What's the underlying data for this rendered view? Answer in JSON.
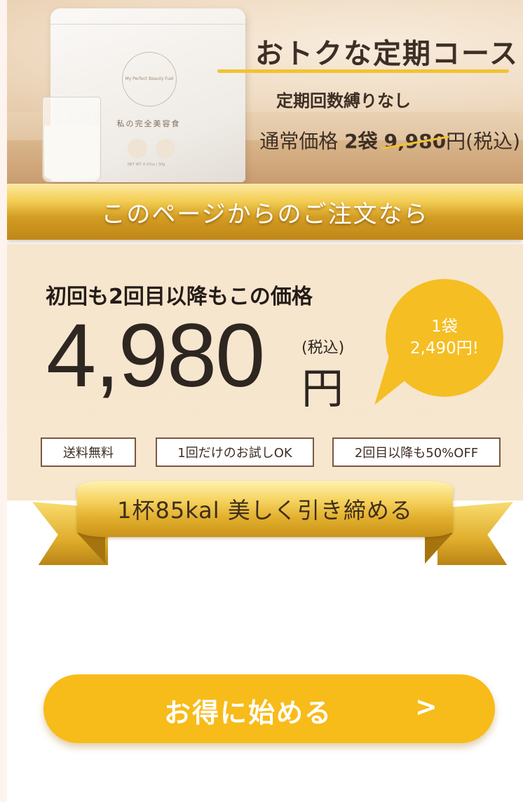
{
  "hero": {
    "title": "おトクな定期コース",
    "subtitle": "定期回数縛りなし",
    "regular_price_label": "通常価格",
    "regular_quantity": "2袋",
    "regular_price_number": "9,980",
    "regular_price_suffix": "円(税込)",
    "product": {
      "brand_text": "My Perfect Beauty Fuel",
      "name_text": "私の完全美容食",
      "net_text": "NET WT. 0.97oz / 30g"
    }
  },
  "banner": {
    "text": "このページからのご注文なら"
  },
  "price": {
    "headline": "初回も2回目以降もこの価格",
    "amount": "4,980",
    "tax_note": "(税込)",
    "currency": "円",
    "bubble": {
      "line1": "1袋",
      "line2": "2,490円!"
    },
    "tags": [
      "送料無料",
      "1回だけのお試しOK",
      "2回目以降も50%OFF"
    ]
  },
  "ribbon": {
    "text": "1杯85kal 美しく引き締める"
  },
  "cta": {
    "label": "お得に始める",
    "arrow": ">"
  },
  "colors": {
    "accent": "#f7bb1a",
    "gold": "#e3b02e",
    "panel_bg": "#f6e6cd",
    "text_dark": "#2e2620",
    "tag_border": "#7a5845"
  },
  "icons": {
    "cta_arrow": "chevron-right-icon"
  }
}
